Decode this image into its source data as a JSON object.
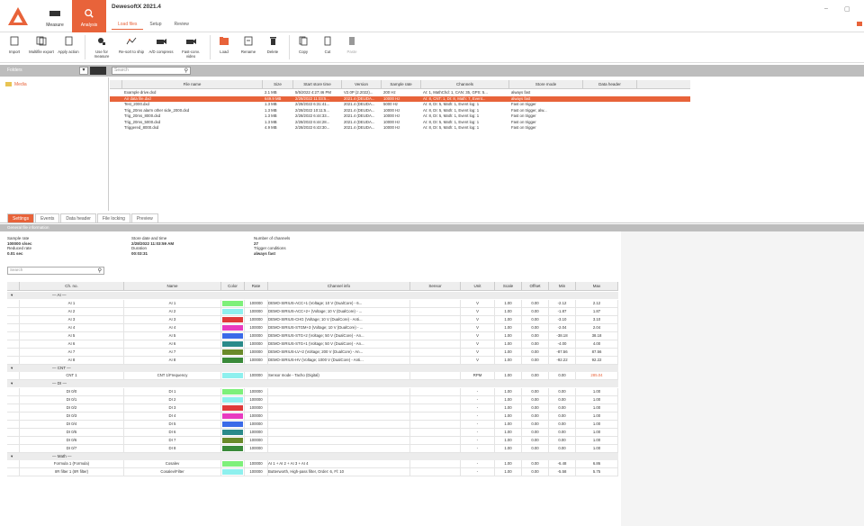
{
  "app": {
    "title": "DewesoftX 2021.4",
    "modes": [
      {
        "id": "measure",
        "label": "Measure"
      },
      {
        "id": "analysis",
        "label": "Analysis"
      }
    ],
    "tabs": [
      "Load files",
      "Setup",
      "Review"
    ],
    "window_controls": [
      "–",
      "▢"
    ]
  },
  "toolbar": [
    {
      "label": "Import",
      "icon": "import-icon",
      "id": "import"
    },
    {
      "label": "Multifile export",
      "icon": "multifile-export-icon",
      "id": "multifile-export"
    },
    {
      "label": "Apply action",
      "icon": "apply-action-icon",
      "id": "apply-action"
    },
    {
      "label": "Use for measure",
      "icon": "use-for-measure-icon",
      "id": "use-for-measure"
    },
    {
      "label": "Re-sort to ship",
      "icon": "resort-icon",
      "id": "resort"
    },
    {
      "label": "A/D compress",
      "icon": "compress-icon",
      "id": "compress"
    },
    {
      "label": "Fast-conv. video",
      "icon": "video-icon",
      "id": "fast-conv-video"
    },
    {
      "label": "Load",
      "icon": "load-icon",
      "id": "load"
    },
    {
      "label": "Rename",
      "icon": "rename-icon",
      "id": "rename"
    },
    {
      "label": "Delete",
      "icon": "delete-icon",
      "id": "delete"
    },
    {
      "label": "Copy",
      "icon": "copy-icon",
      "id": "copy"
    },
    {
      "label": "Cut",
      "icon": "cut-icon",
      "id": "cut"
    },
    {
      "label": "Paste",
      "icon": "paste-icon",
      "id": "paste"
    }
  ],
  "filters": {
    "folder_label": "Folders",
    "search_placeholder": "Search"
  },
  "tree": {
    "root": "Media"
  },
  "file_table": {
    "columns": [
      "",
      "File name",
      "Size",
      "Start store time",
      "Version",
      "Sample rate",
      "Channels",
      "Store mode",
      "Data header"
    ],
    "rows": [
      [
        "",
        "Example drive.dxd",
        "2.1 MB",
        "5/5/2022 4:27:46 PM",
        "V2.0P (2.2022)...",
        "200 Hz",
        "AI: 1, MathChd: 1, CAN: 35, GPS: 5...",
        "always fast",
        ""
      ],
      [
        "",
        "Air data file.dxd",
        "649.9 MB",
        "2/28/2022 11:03:5...",
        "2021.4 (DEUDA...",
        "10000 Hz",
        "AI: 8, CNT: 1, DI: 8, Math: 7, Event...",
        "always fast",
        ""
      ],
      [
        "",
        "Test_2000.dxd",
        "1.3 MB",
        "2/28/2022 6:31:41...",
        "2021.4 (DEUDA...",
        "5000 Hz",
        "AI: 8, DI: 5, Math: 1, Event log: 1",
        "Fast on trigger",
        ""
      ],
      [
        "",
        "Trig_20ms alarm other side_2000.dxd",
        "1.3 MB",
        "2/28/2022 10:11:5...",
        "2021.4 (DEUDA...",
        "10000 Hz",
        "AI: 8, DI: 5, Math: 1, Event log: 1",
        "Fast on trigger, alw...",
        ""
      ],
      [
        "",
        "Trig_20ms_8000.dxd",
        "1.3 MB",
        "2/28/2022 6:44:33...",
        "2021.4 (DEUDA...",
        "10000 Hz",
        "AI: 8, DI: 5, Math: 1, Event log: 1",
        "Fast on trigger",
        ""
      ],
      [
        "",
        "Trig_20ms_5000.dxd",
        "1.3 MB",
        "2/28/2022 6:44:28...",
        "2021.4 (DEUDA...",
        "10000 Hz",
        "AI: 8, DI: 5, Math: 1, Event log: 1",
        "Fast on trigger",
        ""
      ],
      [
        "",
        "Triggered_8000.dxd",
        "4.9 MB",
        "2/28/2022 6:43:30...",
        "2021.4 (DEUDA...",
        "10000 Hz",
        "AI: 8, DI: 5, Math: 1, Event log: 1",
        "Fast on trigger",
        ""
      ]
    ],
    "selected_row": 1
  },
  "bottom_tabs": [
    "Settings",
    "Events",
    "Data header",
    "File locking",
    "Preview"
  ],
  "info_header": "General file information",
  "info": {
    "sample_rate_label": "Sample rate",
    "sample_rate": "100000 s/sec",
    "reduced_rate_label": "Reduced rate",
    "reduced_rate": "0.01 sec",
    "store_date_label": "Store date and time",
    "store_date": "2/28/2022 11:03:59 AM",
    "duration_label": "Duration",
    "duration": "00:03:31",
    "num_channels_label": "Number of channels",
    "num_channels": "27",
    "trigger_label": "Trigger conditions",
    "trigger": "always fast"
  },
  "channel_search_placeholder": "Search",
  "channel_table": {
    "columns": [
      "",
      "Ch. no.",
      "Name",
      "Color",
      "Rate",
      "Channel info",
      "Sensor",
      "Unit",
      "Scale",
      "Offset",
      "Min",
      "Max"
    ],
    "groups": [
      {
        "label": "— AI —",
        "rows": [
          [
            "AI 1",
            "AI 1",
            "#7ef07a",
            "100000",
            "DEMO-SIRIUS-ACC+1 (Voltage; 10 V (DualCore) - 6...",
            "",
            "V",
            "1.00",
            "0.00",
            "-2.12",
            "2.12"
          ],
          [
            "AI 2",
            "AI 2",
            "#8ef0ee",
            "100000",
            "DEMO-SIRIUS-ACC+2+ (Voltage; 10 V (DualCore) - ...",
            "",
            "V",
            "1.00",
            "0.00",
            "-1.87",
            "1.87"
          ],
          [
            "AI 3",
            "AI 3",
            "#e03a3a",
            "100000",
            "DEMO-SIRIUS-CHG (Voltage; 10 V (DualCore) - Anti...",
            "",
            "V",
            "1.00",
            "0.00",
            "-3.10",
            "3.10"
          ],
          [
            "AI 4",
            "AI 4",
            "#e83ac0",
            "100000",
            "DEMO-SIRIUS-STGM+3 (Voltage; 10 V (DualCore) - ...",
            "",
            "V",
            "1.00",
            "0.00",
            "-2.04",
            "2.04"
          ],
          [
            "AI 5",
            "AI 5",
            "#3a6ae8",
            "100000",
            "DEMO-SIRIUS-STG+2 (Voltage; 50 V (DualCore) - An...",
            "",
            "V",
            "1.00",
            "0.00",
            "-38.18",
            "38.18"
          ],
          [
            "AI 6",
            "AI 6",
            "#2a8a8a",
            "100000",
            "DEMO-SIRIUS-STG+1 (Voltage; 50 V (DualCore) - An...",
            "",
            "V",
            "1.00",
            "0.00",
            "-4.00",
            "4.00"
          ],
          [
            "AI 7",
            "AI 7",
            "#6a8a2a",
            "100000",
            "DEMO-SIRIUS-LV+2 (Voltage; 200 V (DualCore) - An...",
            "",
            "V",
            "1.00",
            "0.00",
            "-87.56",
            "87.56"
          ],
          [
            "AI 8",
            "AI 8",
            "#3a8a3a",
            "100000",
            "DEMO-SIRIUS-HV (Voltage; 1000 V (DualCore) - Anti...",
            "",
            "V",
            "1.00",
            "0.00",
            "-92.22",
            "92.22"
          ]
        ]
      },
      {
        "label": "— CNT —",
        "rows": [
          [
            "CNT 1",
            "CNT 1/Frequency",
            "#8ef0ee",
            "100000",
            "Sensor mode - Tacho (Digital)",
            "",
            "RPM",
            "1.00",
            "0.00",
            "0.00",
            "285.04"
          ]
        ]
      },
      {
        "label": "— DI —",
        "rows": [
          [
            "DI 0/0",
            "DI 1",
            "#7ef07a",
            "100000",
            "",
            "",
            "-",
            "1.00",
            "0.00",
            "0.00",
            "1.00"
          ],
          [
            "DI 0/1",
            "DI 2",
            "#8ef0ee",
            "100000",
            "",
            "",
            "-",
            "1.00",
            "0.00",
            "0.00",
            "1.00"
          ],
          [
            "DI 0/2",
            "DI 3",
            "#e03a3a",
            "100000",
            "",
            "",
            "-",
            "1.00",
            "0.00",
            "0.00",
            "1.00"
          ],
          [
            "DI 0/3",
            "DI 4",
            "#e83ac0",
            "100000",
            "",
            "",
            "-",
            "1.00",
            "0.00",
            "0.00",
            "1.00"
          ],
          [
            "DI 0/4",
            "DI 5",
            "#3a6ae8",
            "100000",
            "",
            "",
            "-",
            "1.00",
            "0.00",
            "0.00",
            "1.00"
          ],
          [
            "DI 0/5",
            "DI 6",
            "#2a8a8a",
            "100000",
            "",
            "",
            "-",
            "1.00",
            "0.00",
            "0.00",
            "1.00"
          ],
          [
            "DI 0/6",
            "DI 7",
            "#6a8a2a",
            "100000",
            "",
            "",
            "-",
            "1.00",
            "0.00",
            "0.00",
            "1.00"
          ],
          [
            "DI 0/7",
            "DI 8",
            "#3a8a3a",
            "100000",
            "",
            "",
            "-",
            "1.00",
            "0.00",
            "0.00",
            "1.00"
          ]
        ]
      },
      {
        "label": "— Math —",
        "rows": [
          [
            "Formula 1 (Formula)",
            "Cosalev",
            "#7ef07a",
            "100000",
            "AI 1 + AI 2 + AI 3 + AI 4",
            "",
            "-",
            "1.00",
            "0.00",
            "-6.48",
            "6.86"
          ],
          [
            "IIR filter 1 (IIR filter)",
            "Cosalev/Filter",
            "#8ef0ee",
            "100000",
            "Butterworth, High-pass filter, Order: 6, Fl: 10",
            "",
            "-",
            "1.00",
            "0.00",
            "-5.58",
            "5.75"
          ]
        ]
      }
    ]
  },
  "colors": {
    "accent": "#e8633a",
    "grey_bar": "#bdbdbd"
  }
}
